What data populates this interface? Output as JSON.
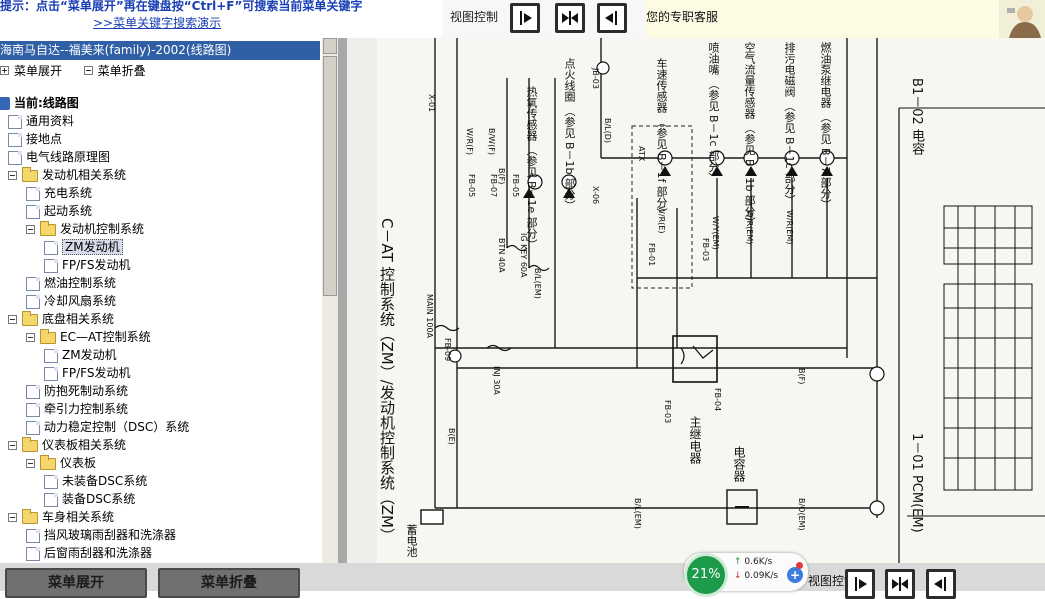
{
  "topbar": {
    "tip": "提示：点击“菜单展开”再在键盘按“Ctrl+F”可搜索当前菜单关键字",
    "demo_link": ">>菜单关键字搜索演示",
    "view_control_label": "视图控制",
    "service_text": "您的专职客服"
  },
  "left_panel": {
    "title": "海南马自达--福美来(family)-2002(线路图)",
    "expand_label": "菜单展开",
    "collapse_label": "菜单折叠",
    "tree": [
      {
        "label": "当前:线路图",
        "icon": "book-icon",
        "level": 0,
        "current": true
      },
      {
        "label": "通用资料",
        "icon": "document-icon",
        "level": 1
      },
      {
        "label": "接地点",
        "icon": "document-icon",
        "level": 1
      },
      {
        "label": "电气线路原理图",
        "icon": "document-icon",
        "level": 1
      },
      {
        "label": "发动机相关系统",
        "icon": "folder-icon",
        "level": 1,
        "expanded": true
      },
      {
        "label": "充电系统",
        "icon": "document-icon",
        "level": 2
      },
      {
        "label": "起动系统",
        "icon": "document-icon",
        "level": 2
      },
      {
        "label": "发动机控制系统",
        "icon": "folder-icon",
        "level": 2,
        "expanded": true
      },
      {
        "label": "ZM发动机",
        "icon": "document-icon",
        "level": 3,
        "selected": true
      },
      {
        "label": "FP/FS发动机",
        "icon": "document-icon",
        "level": 3
      },
      {
        "label": "燃油控制系统",
        "icon": "document-icon",
        "level": 2
      },
      {
        "label": "冷却风扇系统",
        "icon": "document-icon",
        "level": 2
      },
      {
        "label": "底盘相关系统",
        "icon": "folder-icon",
        "level": 1,
        "expanded": true
      },
      {
        "label": "EC—AT控制系统",
        "icon": "folder-icon",
        "level": 2,
        "expanded": true
      },
      {
        "label": "ZM发动机",
        "icon": "document-icon",
        "level": 3
      },
      {
        "label": "FP/FS发动机",
        "icon": "document-icon",
        "level": 3
      },
      {
        "label": "防抱死制动系统",
        "icon": "document-icon",
        "level": 2
      },
      {
        "label": "牵引力控制系统",
        "icon": "document-icon",
        "level": 2
      },
      {
        "label": "动力稳定控制（DSC）系统",
        "icon": "document-icon",
        "level": 2
      },
      {
        "label": "仪表板相关系统",
        "icon": "folder-icon",
        "level": 1,
        "expanded": true
      },
      {
        "label": "仪表板",
        "icon": "folder-icon",
        "level": 2,
        "expanded": true
      },
      {
        "label": "未装备DSC系统",
        "icon": "document-icon",
        "level": 3
      },
      {
        "label": "装备DSC系统",
        "icon": "document-icon",
        "level": 3
      },
      {
        "label": "车身相关系统",
        "icon": "folder-icon",
        "level": 1,
        "expanded": true
      },
      {
        "label": "挡风玻璃雨刮器和洗涤器",
        "icon": "document-icon",
        "level": 2
      },
      {
        "label": "后窗雨刮器和洗涤器",
        "icon": "document-icon",
        "level": 2
      }
    ]
  },
  "diagram": {
    "title_main": "C－AT 控制系统（ZM）/发动机控制系统（ZM）",
    "title_side": "B1－02 电容",
    "pcm_label": "1－01 PCM(EM)",
    "battery_label": "蓄电池",
    "main_relay": "主继电器",
    "capacitor": "电容器",
    "sensors": [
      "热氧传感器 （参见 B－1e 部分）",
      "点火线圈 （参见 B－1b 部分）",
      "车速传感器 （参见 B－1f 部分）",
      "喷油嘴 （参见 B－1c 部分）",
      "空气流量传感器 （参见 B－1b 部分）",
      "排污电磁阀 （参见 B－1c 部分）",
      "燃油泵继电器 （参见 B－7 部分）"
    ],
    "fuse_labels": [
      "MAIN 100A",
      "BTN 40A",
      "IG KEY 60A",
      "INJ 30A"
    ],
    "connector_labels": [
      "FB-09",
      "FB-05",
      "FB-07",
      "FB-05",
      "FB-01",
      "FB-03",
      "FB-03",
      "FB-04",
      "JB-03",
      "X-06",
      "X-01",
      "ATX"
    ],
    "wire_labels": [
      "B(E)",
      "B/L(EM)",
      "W/R(F)",
      "B/W(F)",
      "B(F)",
      "B/L(D)",
      "W/R(E)",
      "W/Y(EM)",
      "W/R(EM)",
      "W/R(EM)",
      "B(F)",
      "B/O(EM)",
      "B/L(EM)"
    ]
  },
  "bottombar": {
    "expand_label": "菜单展开",
    "collapse_label": "菜单折叠",
    "view_control_label": "视图控制",
    "net_percent": "21%",
    "upload_speed": "0.6K/s",
    "download_speed": "0.09K/s",
    "plus": "+"
  },
  "colors": {
    "title_bar": "#2f5fa4",
    "link": "#1a3fb5",
    "service_bg": "#fdfbe3",
    "net_green": "#1e9a4b"
  }
}
